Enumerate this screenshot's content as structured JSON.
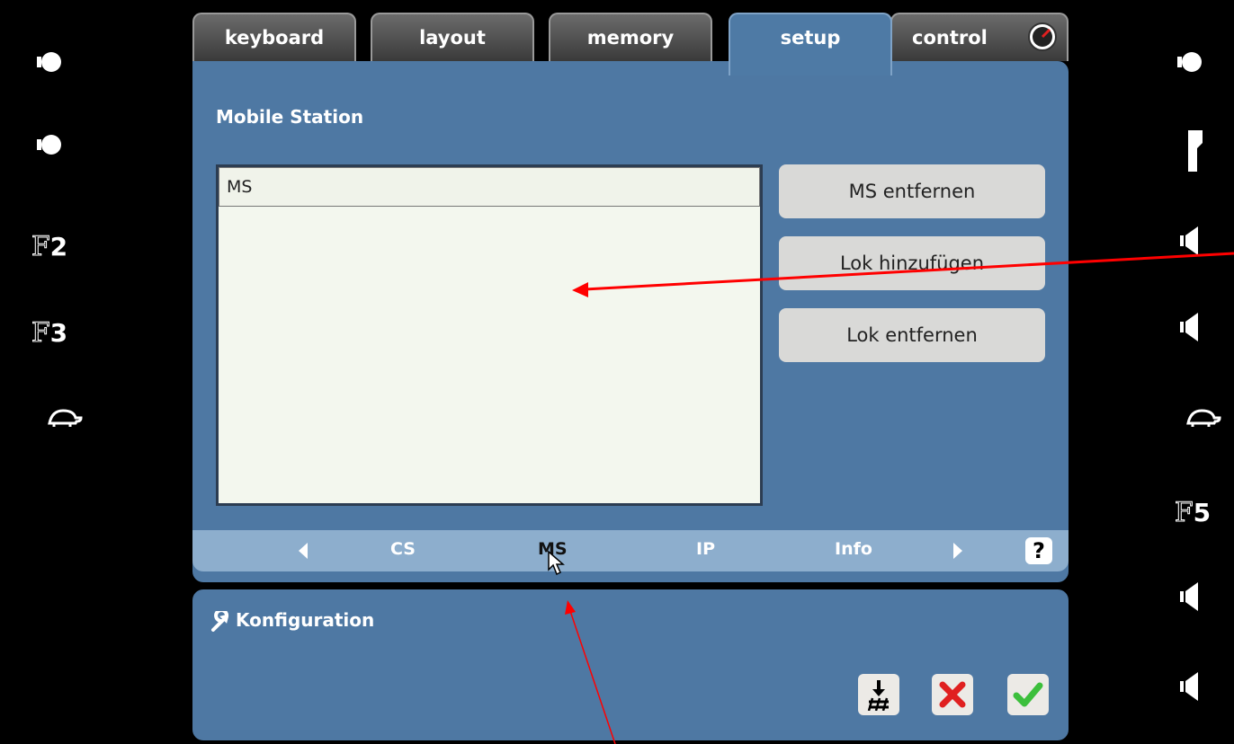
{
  "tabs": [
    {
      "label": "keyboard"
    },
    {
      "label": "layout"
    },
    {
      "label": "memory"
    },
    {
      "label": "setup"
    },
    {
      "label": "control"
    }
  ],
  "left_sidebar": {
    "f2": {
      "letter": "F",
      "num": "2"
    },
    "f3": {
      "letter": "F",
      "num": "3"
    }
  },
  "right_sidebar": {
    "f5": {
      "letter": "F",
      "num": "5"
    }
  },
  "main": {
    "title": "Mobile Station",
    "list_items": [
      "MS"
    ],
    "buttons": {
      "remove_ms": "MS entfernen",
      "add_loco": "Lok hinzufügen",
      "remove_loco": "Lok entfernen"
    },
    "nav": {
      "items": [
        "CS",
        "MS",
        "IP",
        "Info"
      ],
      "selected": "MS",
      "help": "?"
    }
  },
  "config": {
    "title": "Konfiguration"
  },
  "colors": {
    "panel": "#4e78a3",
    "nav_bar": "#8daecd",
    "annotation_arrow": "#ff0000",
    "confirm": "#3cbf3c",
    "cancel": "#e02020"
  }
}
